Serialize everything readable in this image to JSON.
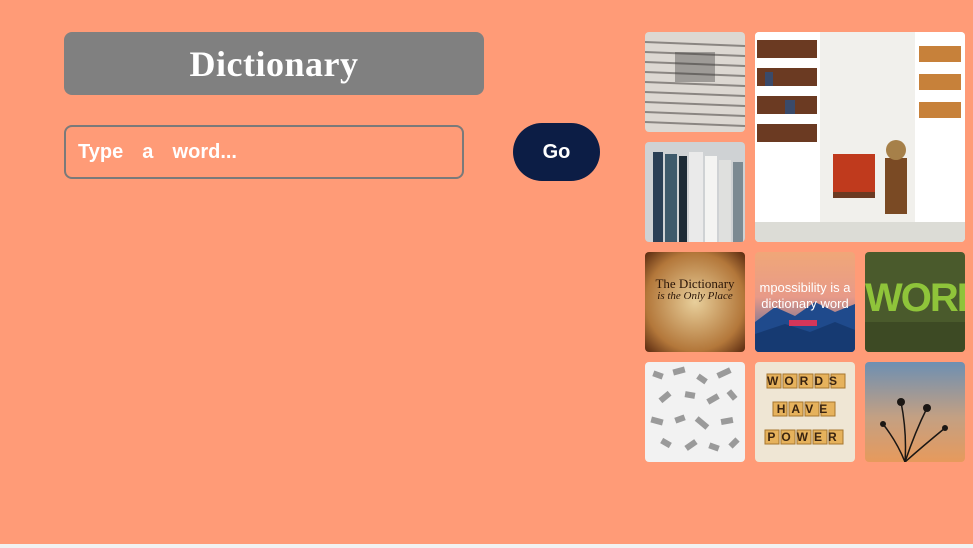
{
  "header": {
    "title": "Dictionary"
  },
  "search": {
    "placeholder": "Type  a  word...",
    "value": ""
  },
  "go_button": {
    "label": "Go"
  },
  "gallery": {
    "items": [
      {
        "name": "dictionary-page-photo"
      },
      {
        "name": "library-room-photo"
      },
      {
        "name": "oxford-books-photo"
      },
      {
        "name": "dictionary-quote-image",
        "text_line1": "The Dictionary",
        "text_line2": "is the Only Place"
      },
      {
        "name": "impossibility-quote-image",
        "text_line1": "mpossibility is a",
        "text_line2": "dictionary word",
        "tag": ""
      },
      {
        "name": "word-green-image",
        "text": "WORD"
      },
      {
        "name": "scattered-letters-photo"
      },
      {
        "name": "scrabble-tiles-photo",
        "rows": [
          "WORDS",
          "HAVE",
          "POWER"
        ]
      },
      {
        "name": "dandelion-sunset-photo"
      }
    ]
  },
  "colors": {
    "background": "#FF9B77",
    "title_bar": "#808080",
    "go_button": "#0c1d45"
  }
}
